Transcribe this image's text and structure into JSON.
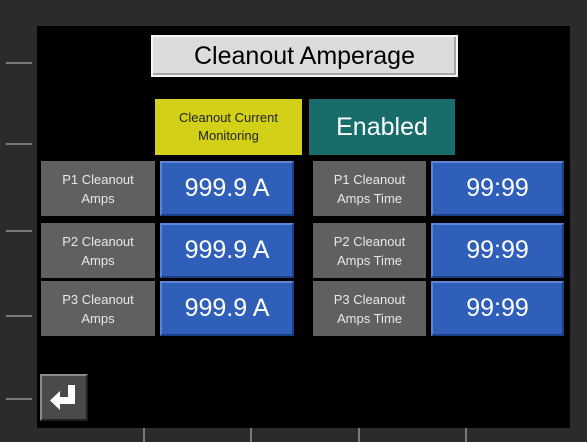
{
  "title": "Cleanout Amperage",
  "monitoring": {
    "button_line1": "Cleanout Current",
    "button_line2": "Monitoring",
    "status": "Enabled"
  },
  "rows": [
    {
      "amps_label_1": "P1 Cleanout",
      "amps_label_2": "Amps",
      "amps_value": "999.9 A",
      "time_label_1": "P1 Cleanout",
      "time_label_2": "Amps Time",
      "time_value": "99:99"
    },
    {
      "amps_label_1": "P2 Cleanout",
      "amps_label_2": "Amps",
      "amps_value": "999.9 A",
      "time_label_1": "P2 Cleanout",
      "time_label_2": "Amps Time",
      "time_value": "99:99"
    },
    {
      "amps_label_1": "P3 Cleanout",
      "amps_label_2": "Amps",
      "amps_value": "999.9 A",
      "time_label_1": "P3 Cleanout",
      "time_label_2": "Amps Time",
      "time_value": "99:99"
    }
  ],
  "back_button": {
    "icon": "return-arrow-icon"
  },
  "colors": {
    "status_teal": "#186c6a",
    "monitor_yellow": "#d3d117",
    "value_blue": "#2f5fb8",
    "label_gray": "#606060"
  }
}
